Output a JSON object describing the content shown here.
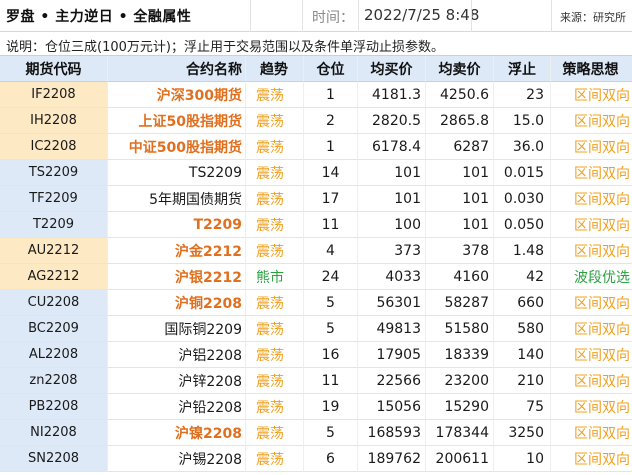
{
  "title": "罗盘 • 主力逆日 • 全融属性",
  "time_label": "时间：",
  "time_value": "2022/7/25 8:48",
  "source": "来源：研究所",
  "note": "说明：仓位三成(100万元计)；浮止用于交易范围以及条件单浮动止损参数。",
  "colors": {
    "stock_group_bg": "#fde9c4",
    "bond_group_bg": "#dde9f7",
    "metal_group_bg": "#fde9c4",
    "base_group_bg": "#dde9f7",
    "header_bg": "#dde9f7",
    "emphasis_text": "#e07020",
    "trend_text": "#f0a020",
    "green_text": "#2aa040"
  },
  "header": {
    "code": "期货代码",
    "name": "合约名称",
    "trend": "趋势",
    "position": "仓位",
    "buy": "均买价",
    "sell": "均卖价",
    "float": "浮止",
    "strategy": "策略思想"
  },
  "rows": [
    {
      "code": "IF2208",
      "name": "沪深300期货",
      "name_em": true,
      "trend": "震荡",
      "position": "1",
      "buy": "4181.3",
      "sell": "4250.6",
      "float": "23",
      "strategy": "区间双向",
      "group": "stock"
    },
    {
      "code": "IH2208",
      "name": "上证50股指期货",
      "name_em": true,
      "trend": "震荡",
      "position": "2",
      "buy": "2820.5",
      "sell": "2865.8",
      "float": "15.0",
      "strategy": "区间双向",
      "group": "stock"
    },
    {
      "code": "IC2208",
      "name": "中证500股指期货",
      "name_em": true,
      "trend": "震荡",
      "position": "1",
      "buy": "6178.4",
      "sell": "6287",
      "float": "36.0",
      "strategy": "区间双向",
      "group": "stock"
    },
    {
      "code": "TS2209",
      "name": "TS2209",
      "name_em": false,
      "trend": "震荡",
      "position": "14",
      "buy": "101",
      "sell": "101",
      "float": "0.015",
      "strategy": "区间双向",
      "group": "bond"
    },
    {
      "code": "TF2209",
      "name": "5年期国债期货",
      "name_em": false,
      "trend": "震荡",
      "position": "17",
      "buy": "101",
      "sell": "101",
      "float": "0.030",
      "strategy": "区间双向",
      "group": "bond"
    },
    {
      "code": "T2209",
      "name": "T2209",
      "name_em": true,
      "trend": "震荡",
      "position": "11",
      "buy": "100",
      "sell": "101",
      "float": "0.050",
      "strategy": "区间双向",
      "group": "bond"
    },
    {
      "code": "AU2212",
      "name": "沪金2212",
      "name_em": true,
      "trend": "震荡",
      "position": "4",
      "buy": "373",
      "sell": "378",
      "float": "1.48",
      "strategy": "区间双向",
      "group": "metal"
    },
    {
      "code": "AG2212",
      "name": "沪银2212",
      "name_em": true,
      "trend": "熊市",
      "trend_green": true,
      "position": "24",
      "buy": "4033",
      "sell": "4160",
      "float": "42",
      "strategy": "波段优选",
      "strategy_green": true,
      "group": "metal"
    },
    {
      "code": "CU2208",
      "name": "沪铜2208",
      "name_em": true,
      "trend": "震荡",
      "position": "5",
      "buy": "56301",
      "sell": "58287",
      "float": "660",
      "strategy": "区间双向",
      "group": "base"
    },
    {
      "code": "BC2209",
      "name": "国际铜2209",
      "name_em": false,
      "trend": "震荡",
      "position": "5",
      "buy": "49813",
      "sell": "51580",
      "float": "580",
      "strategy": "区间双向",
      "group": "base"
    },
    {
      "code": "AL2208",
      "name": "沪铝2208",
      "name_em": false,
      "trend": "震荡",
      "position": "16",
      "buy": "17905",
      "sell": "18339",
      "float": "140",
      "strategy": "区间双向",
      "group": "base"
    },
    {
      "code": "zn2208",
      "name": "沪锌2208",
      "name_em": false,
      "trend": "震荡",
      "position": "11",
      "buy": "22566",
      "sell": "23200",
      "float": "210",
      "strategy": "区间双向",
      "group": "base"
    },
    {
      "code": "PB2208",
      "name": "沪铅2208",
      "name_em": false,
      "trend": "震荡",
      "position": "19",
      "buy": "15056",
      "sell": "15290",
      "float": "75",
      "strategy": "区间双向",
      "group": "base"
    },
    {
      "code": "NI2208",
      "name": "沪镍2208",
      "name_em": true,
      "trend": "震荡",
      "position": "5",
      "buy": "168593",
      "sell": "178344",
      "float": "3250",
      "strategy": "区间双向",
      "group": "base"
    },
    {
      "code": "SN2208",
      "name": "沪锡2208",
      "name_em": false,
      "trend": "震荡",
      "position": "6",
      "buy": "189762",
      "sell": "200611",
      "float": "10",
      "strategy": "区间双向",
      "group": "base"
    }
  ]
}
